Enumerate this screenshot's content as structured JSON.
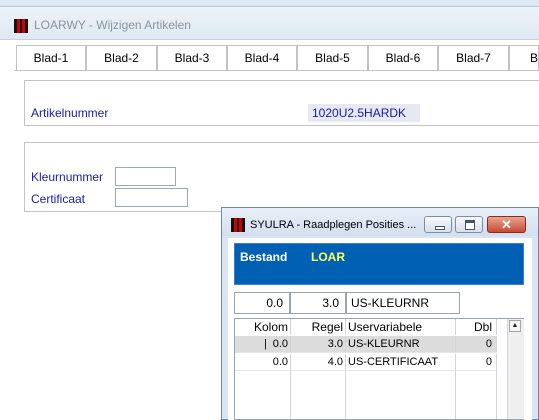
{
  "main_window": {
    "title": "LOARWY - Wijzigen Artikelen",
    "tabs": [
      "Blad-1",
      "Blad-2",
      "Blad-3",
      "Blad-4",
      "Blad-5",
      "Blad-6",
      "Blad-7",
      "Bla"
    ]
  },
  "article": {
    "label": "Artikelnummer",
    "value": "1020U2.5HARDK"
  },
  "fields": {
    "kleurnummer_label": "Kleurnummer",
    "kleurnummer_value": "",
    "certificaat_label": "Certificaat",
    "certificaat_value": ""
  },
  "dialog": {
    "title": "SYULRA - Raadplegen Posities ...",
    "close_glyph": "✕",
    "bestand_label": "Bestand",
    "bestand_value": "LOAR",
    "position": {
      "kolom": "0.0",
      "regel": "3.0",
      "uservariabele": "US-KLEURNR"
    },
    "columns": [
      "Kolom",
      "Regel",
      "Uservariabele",
      "Dbl"
    ],
    "rows": [
      {
        "kolom": "0.0",
        "regel": "3.0",
        "var": "US-KLEURNR",
        "dbl": "0"
      },
      {
        "kolom": "0.0",
        "regel": "4.0",
        "var": "US-CERTIFICAAT",
        "dbl": "0"
      }
    ]
  },
  "colors": {
    "label_blue": "#1a1aa6",
    "panel_blue": "#0061b4",
    "bestand_value_yellow": "#ffff5a"
  }
}
